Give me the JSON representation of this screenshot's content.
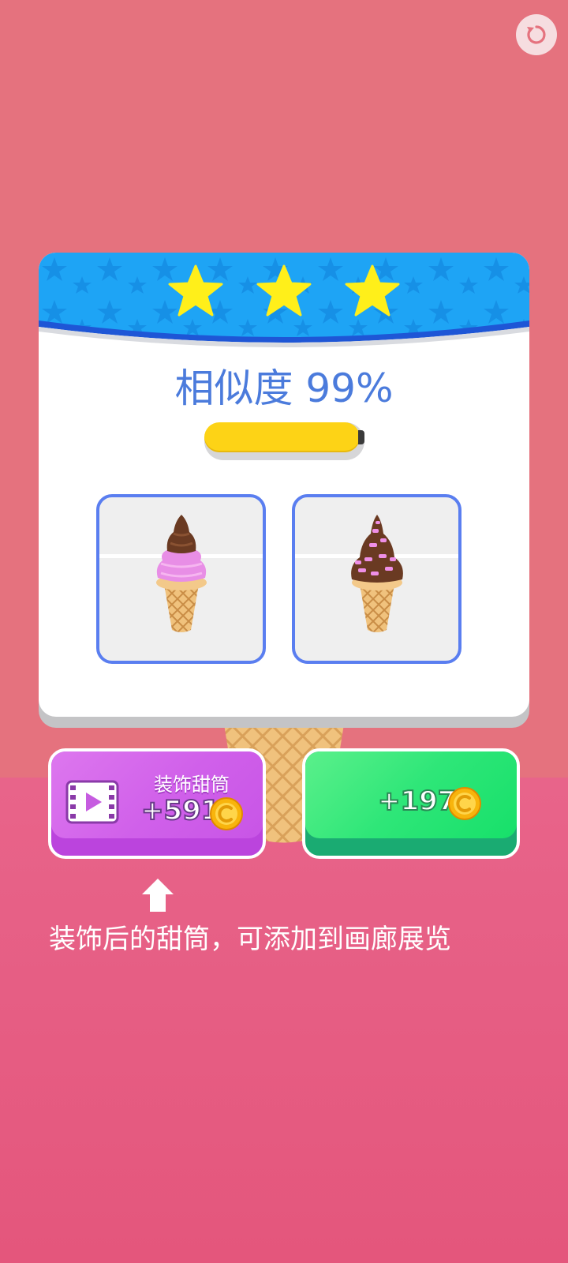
{
  "hud": {
    "restart_icon": "restart-icon"
  },
  "result": {
    "stars_earned": 3,
    "stars_total": 3,
    "similarity_label": "相似度",
    "similarity_value": "99%",
    "progress": 0.97
  },
  "thumbnails": [
    {
      "name": "target-icecream-thumb",
      "icon": "icecream-cone-icon"
    },
    {
      "name": "player-icecream-thumb",
      "icon": "icecream-cone-sprinkles-icon"
    }
  ],
  "buttons": {
    "decorate": {
      "title": "装饰甜筒",
      "reward": "+591",
      "icon": "video-ad-icon",
      "coin_icon": "coin-icon"
    },
    "collect": {
      "reward": "+197",
      "coin_icon": "coin-icon"
    }
  },
  "hint": {
    "text": "装饰后的甜筒，可添加到画廊展览",
    "arrow_icon": "up-arrow-icon"
  },
  "colors": {
    "bg_top": "#e5727e",
    "bg_bottom": "#e4567c",
    "header_blue": "#1ea4f5",
    "star_yellow": "#ffef1a",
    "similarity_blue": "#4b7bdc",
    "progress_yellow": "#fdd316",
    "purple_button": "#d060ea",
    "green_button": "#2ee678"
  }
}
